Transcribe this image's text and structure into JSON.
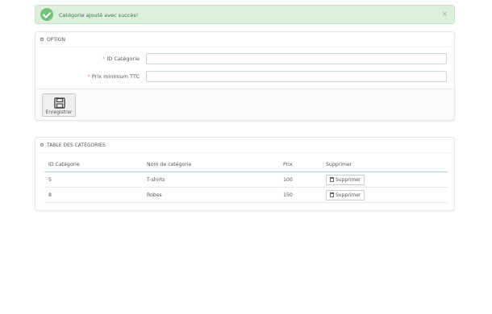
{
  "alert": {
    "message": "Catégorie ajouté avec succès!",
    "close": "×"
  },
  "option_panel": {
    "title": "OPTION",
    "fields": [
      {
        "required": "*",
        "label": "ID Catégorie",
        "value": ""
      },
      {
        "required": "*",
        "label": "Prix minimum TTC",
        "value": ""
      }
    ],
    "save_label": "Enregistrer"
  },
  "table_panel": {
    "title": "TABLE DES CATÉGORIES",
    "columns": [
      "ID Catégorie",
      "Nom de catégorie",
      "Prix",
      "Supprimer"
    ],
    "rows": [
      {
        "id": "5",
        "name": "T-shirts",
        "price": "100",
        "action": "Supprimer"
      },
      {
        "id": "8",
        "name": "Robes",
        "price": "150",
        "action": "Supprimer"
      }
    ]
  }
}
